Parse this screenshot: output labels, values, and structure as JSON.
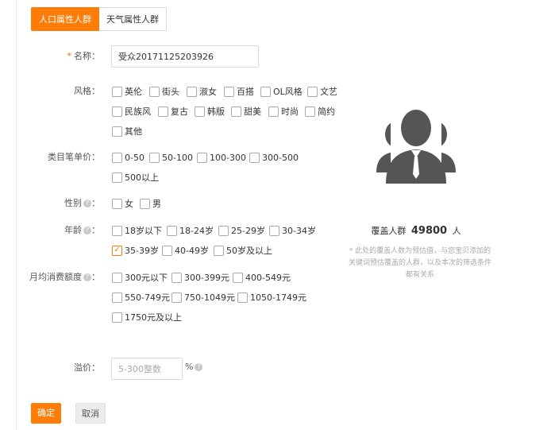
{
  "tabs": [
    {
      "label": "人口属性人群",
      "active": true
    },
    {
      "label": "天气属性人群",
      "active": false
    }
  ],
  "name": {
    "label": "名称：",
    "required_mark": "*",
    "value": "受众20171125203926"
  },
  "style": {
    "label": "风格：",
    "options": [
      "英伦",
      "街头",
      "淑女",
      "百搭",
      "OL风格",
      "文艺",
      "民族风",
      "复古",
      "韩版",
      "甜美",
      "时尚",
      "简约",
      "其他"
    ]
  },
  "price": {
    "label": "类目笔单价：",
    "options": [
      "0-50",
      "50-100",
      "100-300",
      "300-500",
      "500以上"
    ]
  },
  "gender": {
    "label": "性别",
    "options": [
      "女",
      "男"
    ]
  },
  "age": {
    "label": "年龄",
    "options": [
      "18岁以下",
      "18-24岁",
      "25-29岁",
      "30-34岁",
      "35-39岁",
      "40-49岁",
      "50岁及以上"
    ],
    "checked": [
      "35-39岁"
    ]
  },
  "spend": {
    "label": "月均消费额度",
    "options": [
      "300元以下",
      "300-399元",
      "400-549元",
      "550-749元",
      "750-1049元",
      "1050-1749元",
      "1750元及以上"
    ]
  },
  "premium": {
    "label": "溢价：",
    "placeholder": "5-300整数",
    "unit": "%"
  },
  "help_icon": "?",
  "check_icon": "✓",
  "coverage": {
    "prefix": "覆盖人群",
    "count": "49800",
    "unit": "人",
    "note_line1": "* 此处的覆盖人数为预估值，与您宝贝添加的",
    "note_line2": "关键词预估覆盖的人群，以及本次的筛选条件",
    "note_line3": "都有关系"
  },
  "buttons": {
    "confirm": "确定",
    "cancel": "取消"
  },
  "colors": {
    "accent": "#ff7c09",
    "avatar": "#555555"
  }
}
